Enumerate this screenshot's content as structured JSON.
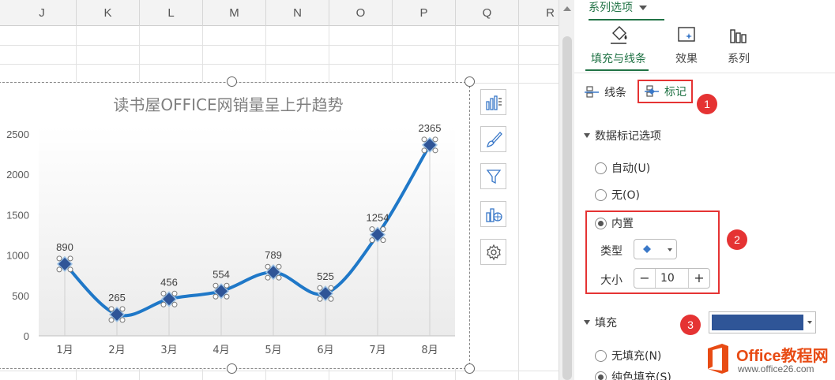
{
  "columns": [
    "J",
    "K",
    "L",
    "M",
    "N",
    "O",
    "P",
    "Q",
    "R"
  ],
  "chart_data": {
    "type": "line",
    "title": "读书屋OFFICE网销量呈上升趋势",
    "categories": [
      "1月",
      "2月",
      "3月",
      "4月",
      "5月",
      "6月",
      "7月",
      "8月"
    ],
    "values": [
      890,
      265,
      456,
      554,
      789,
      525,
      1254,
      2365
    ],
    "data_labels": [
      "890",
      "265",
      "456",
      "554",
      "789",
      "525",
      "1254",
      "2365"
    ],
    "yticks": [
      "0",
      "500",
      "1000",
      "1500",
      "2000",
      "2500"
    ],
    "ylim": [
      0,
      2500
    ],
    "smooth": true,
    "line_color": "#1f78c8",
    "marker": "diamond",
    "marker_color": "#2f5597"
  },
  "side_buttons": [
    "chart-elements-icon",
    "chart-style-icon",
    "chart-filter-icon",
    "chart-type-icon",
    "settings-icon"
  ],
  "pane": {
    "title": "系列选项",
    "tabs": [
      {
        "label": "填充与线条",
        "icon": "fill-bucket-icon"
      },
      {
        "label": "效果",
        "icon": "effects-icon"
      },
      {
        "label": "系列",
        "icon": "series-icon"
      }
    ],
    "subtabs": {
      "line": "线条",
      "marker": "标记"
    },
    "marker_section": "数据标记选项",
    "options": {
      "auto": "自动(U)",
      "none": "无(O)",
      "builtin": "内置"
    },
    "type_label": "类型",
    "size_label": "大小",
    "size_value": "10",
    "fill_section": "填充",
    "fill_color": "#2f5597",
    "fill_options": {
      "no_fill": "无填充(N)",
      "solid": "纯色填充(S)"
    },
    "callouts": [
      "1",
      "2",
      "3"
    ]
  },
  "watermark": {
    "name": "Office教程网",
    "url": "www.office26.com"
  }
}
